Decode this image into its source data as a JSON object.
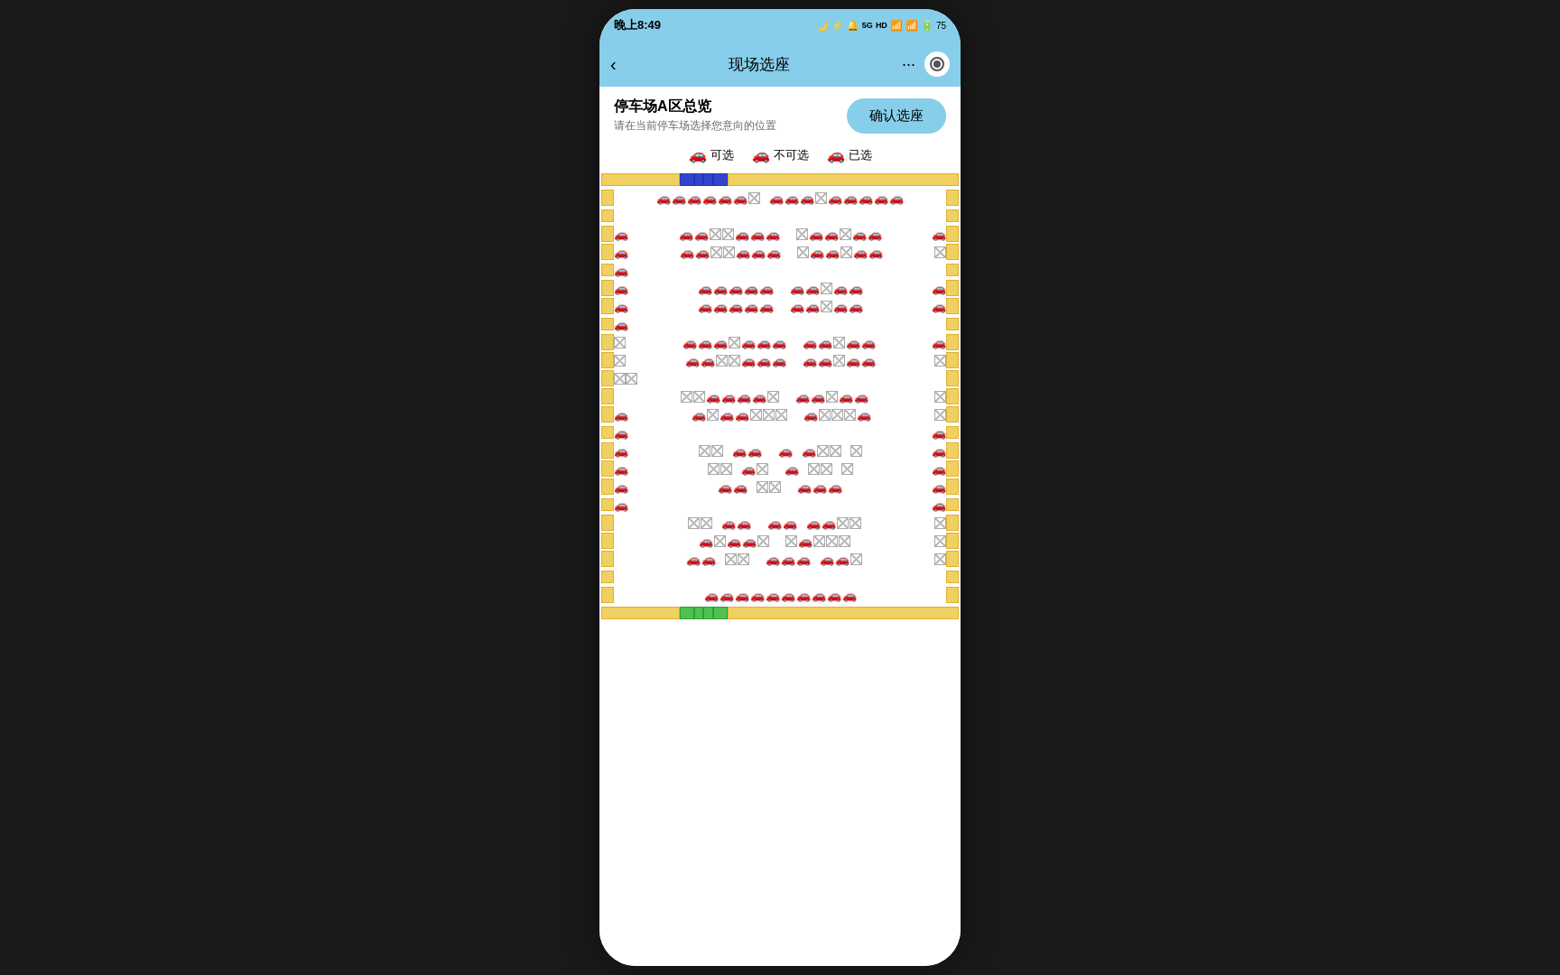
{
  "statusBar": {
    "time": "晚上8:49",
    "icons": "🌙 ♦ ☎ ⏰ 5G HD 📶 📶 🔋75"
  },
  "navBar": {
    "backLabel": "‹",
    "title": "现场选座",
    "menuLabel": "···"
  },
  "header": {
    "title": "停车场A区总览",
    "subtitle": "请在当前停车场选择您意向的位置",
    "confirmLabel": "确认选座"
  },
  "legend": {
    "available": "可选",
    "unavailable": "不可选",
    "selected": "已选"
  }
}
